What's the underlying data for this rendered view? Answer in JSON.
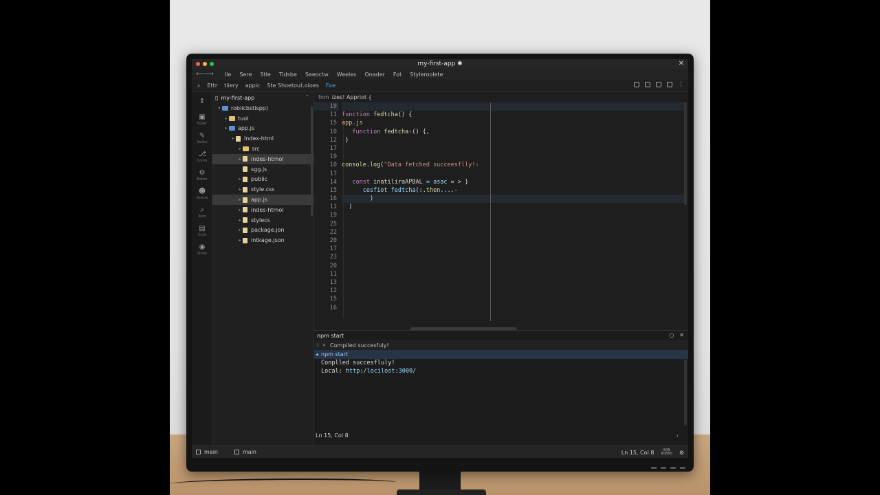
{
  "window": {
    "title": "my-first-app ✱"
  },
  "menu": {
    "items": [
      "Ile",
      "Sere",
      "Stle",
      "Tidsbe",
      "Seeoctw",
      "Weeles",
      "Onader",
      "Fot",
      "Styleroolete"
    ]
  },
  "toolbar": {
    "items": [
      "Ettr",
      "tiiery",
      "appic",
      "Ste Shoetout.oioes"
    ],
    "active": "Foe"
  },
  "activity": {
    "items": [
      {
        "icon": "explorer-icon",
        "label": "Eglier"
      },
      {
        "icon": "edit-icon",
        "label": "Sodce"
      },
      {
        "icon": "source-control-icon",
        "label": "Conre"
      },
      {
        "icon": "extensions-icon",
        "label": "Edicie"
      },
      {
        "icon": "users-icon",
        "label": "Scecie"
      },
      {
        "icon": "run-icon",
        "label": "Rom"
      },
      {
        "icon": "terminal-icon",
        "label": "Cnck"
      },
      {
        "icon": "settings-icon",
        "label": "Stries"
      }
    ]
  },
  "explorer": {
    "root": "my-first-app",
    "tree": [
      {
        "label": "robiicbstispp)",
        "indent": 0,
        "kind": "folder-blue",
        "arrow": "▾",
        "selected": false
      },
      {
        "label": "tuol",
        "indent": 1,
        "kind": "folder",
        "arrow": "▸",
        "selected": false
      },
      {
        "label": "app.js",
        "indent": 1,
        "kind": "folder-blue",
        "arrow": "▸",
        "selected": false
      },
      {
        "label": "index-html",
        "indent": 2,
        "kind": "file",
        "arrow": "▸",
        "selected": false
      },
      {
        "label": "src",
        "indent": 3,
        "kind": "folder",
        "arrow": "▸",
        "selected": false
      },
      {
        "label": "indes-htmol",
        "indent": 3,
        "kind": "file",
        "arrow": "▸",
        "selected": true
      },
      {
        "label": "sgg.js",
        "indent": 3,
        "kind": "file",
        "arrow": "",
        "selected": false
      },
      {
        "label": "public",
        "indent": 3,
        "kind": "file",
        "arrow": "▸",
        "selected": false
      },
      {
        "label": "style.css",
        "indent": 3,
        "kind": "file",
        "arrow": "▸",
        "selected": false
      },
      {
        "label": "app.js",
        "indent": 3,
        "kind": "file",
        "arrow": "▸",
        "selected": true
      },
      {
        "label": "indes-htmol",
        "indent": 3,
        "kind": "file",
        "arrow": "▸",
        "selected": false
      },
      {
        "label": "stylecs",
        "indent": 3,
        "kind": "file",
        "arrow": "▸",
        "selected": false
      },
      {
        "label": "package.jon",
        "indent": 3,
        "kind": "file",
        "arrow": "▸",
        "selected": false
      },
      {
        "label": "intkage.json",
        "indent": 3,
        "kind": "file",
        "arrow": "▸",
        "selected": false
      }
    ]
  },
  "editor": {
    "breadcrumb_kw": "fnm",
    "breadcrumb": "izes! Appriot {",
    "line_numbers": [
      "10",
      "11",
      "15",
      "10",
      "12",
      "17",
      "19",
      "10",
      "17",
      "14",
      "15",
      "16",
      "11",
      "19",
      "25",
      "22",
      "20",
      "17",
      "23",
      "20",
      "11",
      "13",
      "12",
      "15",
      "16"
    ],
    "lines": [
      [],
      [
        {
          "c": "k",
          "t": "function "
        },
        {
          "c": "f",
          "t": "fedtcha"
        },
        {
          "c": "",
          "t": "() {"
        }
      ],
      [
        {
          "c": "y",
          "t": "app.js"
        }
      ],
      [
        {
          "c": "",
          "t": "   "
        },
        {
          "c": "k",
          "t": "function "
        },
        {
          "c": "f",
          "t": "fedtcha"
        },
        {
          "c": "s",
          "t": "‹"
        },
        {
          "c": "",
          "t": "() {,"
        }
      ],
      [
        {
          "c": "",
          "t": " }"
        }
      ],
      [],
      [],
      [
        {
          "c": "f",
          "t": "console.log"
        },
        {
          "c": "",
          "t": "("
        },
        {
          "c": "s",
          "t": "\"Data fetched succeesflly!‹"
        }
      ],
      [],
      [
        {
          "c": "",
          "t": "   "
        },
        {
          "c": "k",
          "t": "const "
        },
        {
          "c": "",
          "t": "inatiliraAPBAL "
        },
        {
          "c": "c",
          "t": "= asac "
        },
        {
          "c": "",
          "t": "= > }"
        }
      ],
      [
        {
          "c": "",
          "t": "      "
        },
        {
          "c": "c",
          "t": "cesfiot fedtcha"
        },
        {
          "c": "",
          "t": "(:"
        },
        {
          "c": "f",
          "t": ".then.."
        },
        {
          "c": "",
          "t": "..-"
        }
      ],
      [
        {
          "c": "",
          "t": "        )"
        }
      ],
      [
        {
          "c": "",
          "t": "  )"
        }
      ]
    ]
  },
  "terminal": {
    "title": "npm start",
    "subtitle": "Compiled succesfuly!",
    "task": "npm start",
    "output_line1": "Conplled succesfluly!",
    "local_label": "Local:",
    "local_url": "http:/locilost:3000/",
    "cursor_pos": "Ln 15, Col 8"
  },
  "status": {
    "left_items": [
      "main",
      "main"
    ],
    "right_pos": "Ln 15, Col 8",
    "tiny_top": "80B",
    "tiny_bottom": "80BB0"
  }
}
